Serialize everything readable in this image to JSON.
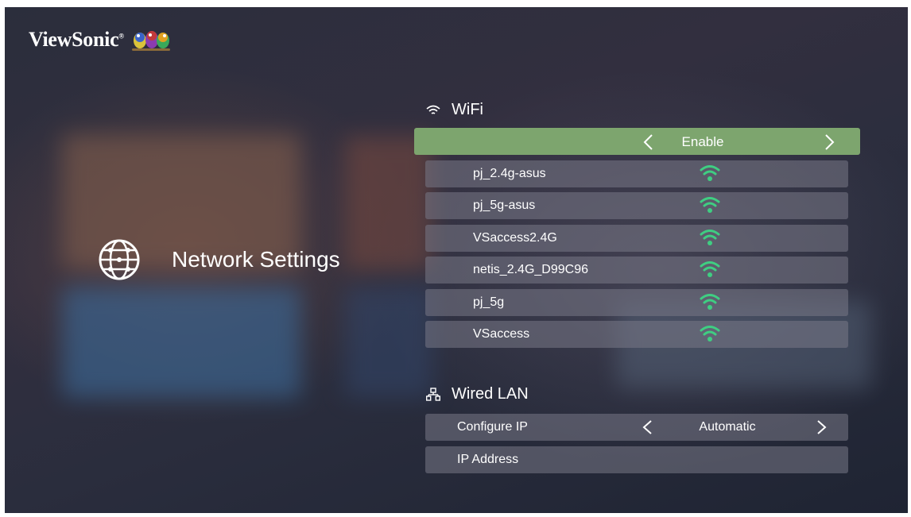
{
  "brand": {
    "name": "ViewSonic",
    "mark": "®"
  },
  "left_panel": {
    "icon": "globe-icon",
    "title": "Network Settings"
  },
  "wifi": {
    "header": "WiFi",
    "header_icon": "wifi-icon",
    "toggle": {
      "value": "Enable"
    },
    "networks": [
      {
        "ssid": "pj_2.4g-asus"
      },
      {
        "ssid": "pj_5g-asus"
      },
      {
        "ssid": "VSaccess2.4G"
      },
      {
        "ssid": "netis_2.4G_D99C96"
      },
      {
        "ssid": "pj_5g"
      },
      {
        "ssid": "VSaccess"
      }
    ],
    "signal_color": "#3fce82"
  },
  "wired_lan": {
    "header": "Wired LAN",
    "header_icon": "lan-icon",
    "configure_ip": {
      "label": "Configure IP",
      "value": "Automatic"
    },
    "ip_address": {
      "label": "IP Address"
    }
  },
  "colors": {
    "selected_row": "#7da56e"
  }
}
